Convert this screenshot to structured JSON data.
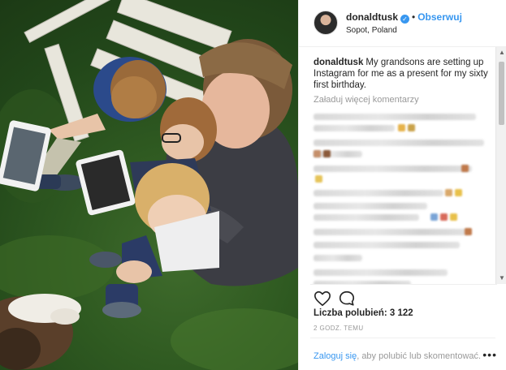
{
  "post": {
    "username": "donaldtusk",
    "follow_label": "Obserwuj",
    "location": "Sopot, Poland",
    "caption_user": "donaldtusk",
    "caption_text": "My grandsons are setting up Instagram for me as a present for my sixty first birthday.",
    "load_more": "Załaduj więcej komentarzy",
    "likes_label": "Liczba polubień: 3 122",
    "time_ago": "2 GODZ. TEMU",
    "login_link": "Zaloguj się",
    "login_rest": ", aby polubić lub skomentować.",
    "more_options": "•••"
  },
  "icons": {
    "verified": "verified-badge-icon",
    "like": "heart-icon",
    "comment": "comment-bubble-icon",
    "scroll_up": "chevron-up-icon",
    "scroll_down": "chevron-down-icon"
  },
  "colors": {
    "accent": "#3897f0",
    "text": "#262626",
    "muted": "#999999",
    "border": "#efefef"
  }
}
